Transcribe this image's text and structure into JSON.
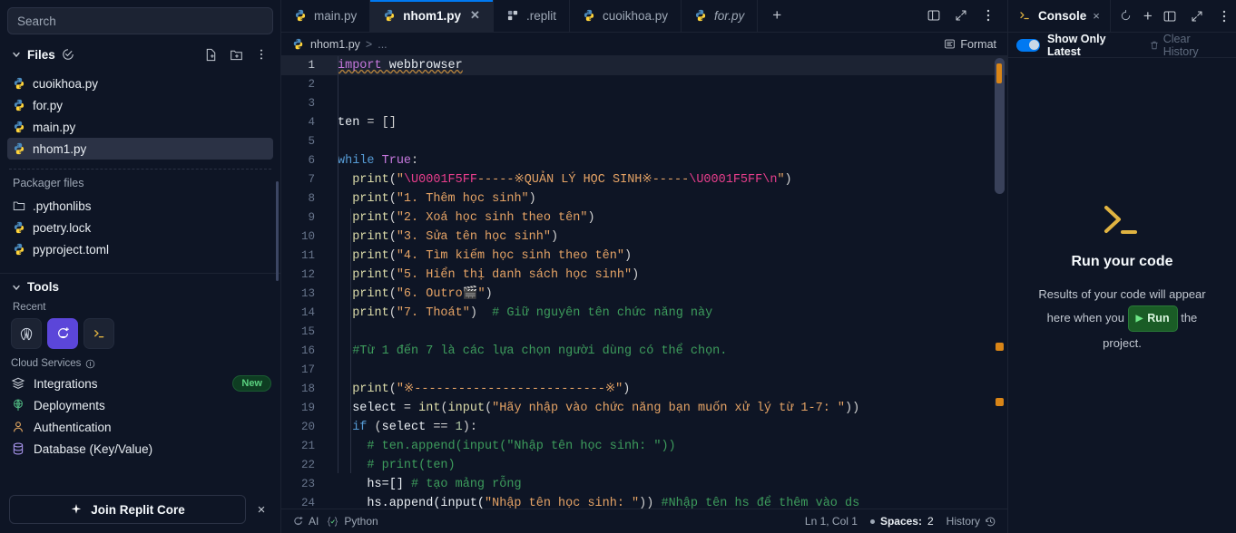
{
  "sidebar": {
    "search": {
      "placeholder": "Search",
      "name": "search-input"
    },
    "files_section": {
      "label": "Files"
    },
    "files": [
      {
        "label": "cuoikhoa.py",
        "icon": "python-icon",
        "active": false
      },
      {
        "label": "for.py",
        "icon": "python-icon",
        "active": false
      },
      {
        "label": "main.py",
        "icon": "python-icon",
        "active": false
      },
      {
        "label": "nhom1.py",
        "icon": "python-icon",
        "active": true
      }
    ],
    "packager_label": "Packager files",
    "packager_files": [
      {
        "label": ".pythonlibs",
        "icon": "folder-icon"
      },
      {
        "label": "poetry.lock",
        "icon": "python-icon"
      },
      {
        "label": "pyproject.toml",
        "icon": "python-icon"
      }
    ],
    "tools_section": {
      "label": "Tools"
    },
    "recent_label": "Recent",
    "recent_tools": [
      {
        "name": "shell-tool-icon",
        "selected": false
      },
      {
        "name": "replit-ai-tool-icon",
        "selected": true
      },
      {
        "name": "console-tool-icon",
        "selected": false
      }
    ],
    "cloud_label": "Cloud Services",
    "cloud_services": [
      {
        "label": "Integrations",
        "icon": "layers-icon",
        "badge": "New"
      },
      {
        "label": "Deployments",
        "icon": "globe-icon",
        "badge": ""
      },
      {
        "label": "Authentication",
        "icon": "person-icon",
        "badge": ""
      },
      {
        "label": "Database (Key/Value)",
        "icon": "database-icon",
        "badge": ""
      }
    ],
    "core_button": {
      "label": "Join Replit Core",
      "icon": "sparkle-icon"
    },
    "core_close": "×"
  },
  "tabs": [
    {
      "label": "main.py",
      "icon": "python-icon",
      "active": false,
      "italic": false,
      "closable": false
    },
    {
      "label": "nhom1.py",
      "icon": "python-icon",
      "active": true,
      "italic": false,
      "closable": true
    },
    {
      "label": ".replit",
      "icon": "replit-config-icon",
      "active": false,
      "italic": false,
      "closable": false
    },
    {
      "label": "cuoikhoa.py",
      "icon": "python-icon",
      "active": false,
      "italic": false,
      "closable": false
    },
    {
      "label": "for.py",
      "icon": "python-icon",
      "active": false,
      "italic": true,
      "closable": false
    }
  ],
  "tabbar": {
    "new_tab": "+",
    "split_icon": "split-pane-icon",
    "expand_icon": "expand-icon",
    "more_icon": "more-vertical-icon"
  },
  "breadcrumb": {
    "file": "nhom1.py",
    "separator": ">",
    "ellipsis": "...",
    "format_label": "Format"
  },
  "editor": {
    "lines": [
      {
        "n": "1",
        "tokens": [
          {
            "t": "import ",
            "c": "kp sq"
          },
          {
            "t": "webbrowser",
            "c": "id sq"
          }
        ],
        "highlight": true,
        "caret": true
      },
      {
        "n": "2",
        "tokens": []
      },
      {
        "n": "3",
        "tokens": []
      },
      {
        "n": "4",
        "tokens": [
          {
            "t": "ten",
            "c": "id"
          },
          {
            "t": " = ",
            "c": "op"
          },
          {
            "t": "[]",
            "c": "op"
          }
        ]
      },
      {
        "n": "5",
        "tokens": []
      },
      {
        "n": "6",
        "tokens": [
          {
            "t": "while",
            "c": "k"
          },
          {
            "t": " ",
            "c": "op"
          },
          {
            "t": "True",
            "c": "kp"
          },
          {
            "t": ":",
            "c": "op"
          }
        ]
      },
      {
        "n": "7",
        "tokens": [
          {
            "t": "  ",
            "c": "op"
          },
          {
            "t": "print",
            "c": "fn"
          },
          {
            "t": "(",
            "c": "op"
          },
          {
            "t": "\"",
            "c": "s"
          },
          {
            "t": "\\U0001F5FF",
            "c": "esc"
          },
          {
            "t": "-----※QUẢN LÝ HỌC SINH※-----",
            "c": "s"
          },
          {
            "t": "\\U0001F5FF",
            "c": "esc"
          },
          {
            "t": "\\n",
            "c": "esc"
          },
          {
            "t": "\"",
            "c": "s"
          },
          {
            "t": ")",
            "c": "op"
          }
        ]
      },
      {
        "n": "8",
        "tokens": [
          {
            "t": "  ",
            "c": "op"
          },
          {
            "t": "print",
            "c": "fn"
          },
          {
            "t": "(",
            "c": "op"
          },
          {
            "t": "\"1. Thêm học sinh\"",
            "c": "s"
          },
          {
            "t": ")",
            "c": "op"
          }
        ]
      },
      {
        "n": "9",
        "tokens": [
          {
            "t": "  ",
            "c": "op"
          },
          {
            "t": "print",
            "c": "fn"
          },
          {
            "t": "(",
            "c": "op"
          },
          {
            "t": "\"2. Xoá học sinh theo tên\"",
            "c": "s"
          },
          {
            "t": ")",
            "c": "op"
          }
        ]
      },
      {
        "n": "10",
        "tokens": [
          {
            "t": "  ",
            "c": "op"
          },
          {
            "t": "print",
            "c": "fn"
          },
          {
            "t": "(",
            "c": "op"
          },
          {
            "t": "\"3. Sửa tên học sinh\"",
            "c": "s"
          },
          {
            "t": ")",
            "c": "op"
          }
        ]
      },
      {
        "n": "11",
        "tokens": [
          {
            "t": "  ",
            "c": "op"
          },
          {
            "t": "print",
            "c": "fn"
          },
          {
            "t": "(",
            "c": "op"
          },
          {
            "t": "\"4. Tìm kiếm học sinh theo tên\"",
            "c": "s"
          },
          {
            "t": ")",
            "c": "op"
          }
        ]
      },
      {
        "n": "12",
        "tokens": [
          {
            "t": "  ",
            "c": "op"
          },
          {
            "t": "print",
            "c": "fn"
          },
          {
            "t": "(",
            "c": "op"
          },
          {
            "t": "\"5. Hiển thị danh sách học sinh\"",
            "c": "s"
          },
          {
            "t": ")",
            "c": "op"
          }
        ]
      },
      {
        "n": "13",
        "tokens": [
          {
            "t": "  ",
            "c": "op"
          },
          {
            "t": "print",
            "c": "fn"
          },
          {
            "t": "(",
            "c": "op"
          },
          {
            "t": "\"6. Outro🎬\"",
            "c": "s"
          },
          {
            "t": ")",
            "c": "op"
          }
        ]
      },
      {
        "n": "14",
        "tokens": [
          {
            "t": "  ",
            "c": "op"
          },
          {
            "t": "print",
            "c": "fn"
          },
          {
            "t": "(",
            "c": "op"
          },
          {
            "t": "\"7. Thoát\"",
            "c": "s"
          },
          {
            "t": ")",
            "c": "op"
          },
          {
            "t": "  # Giữ nguyên tên chức năng này",
            "c": "c"
          }
        ]
      },
      {
        "n": "15",
        "tokens": []
      },
      {
        "n": "16",
        "tokens": [
          {
            "t": "  #Từ 1 đến 7 là các lựa chọn người dùng có thể chọn.",
            "c": "c"
          }
        ]
      },
      {
        "n": "17",
        "tokens": []
      },
      {
        "n": "18",
        "tokens": [
          {
            "t": "  ",
            "c": "op"
          },
          {
            "t": "print",
            "c": "fn"
          },
          {
            "t": "(",
            "c": "op"
          },
          {
            "t": "\"※--------------------------※\"",
            "c": "s"
          },
          {
            "t": ")",
            "c": "op"
          }
        ]
      },
      {
        "n": "19",
        "tokens": [
          {
            "t": "  ",
            "c": "op"
          },
          {
            "t": "select",
            "c": "id"
          },
          {
            "t": " = ",
            "c": "op"
          },
          {
            "t": "int",
            "c": "fn"
          },
          {
            "t": "(",
            "c": "op"
          },
          {
            "t": "input",
            "c": "fn"
          },
          {
            "t": "(",
            "c": "op"
          },
          {
            "t": "\"Hãy nhập vào chức năng bạn muốn xử lý từ 1-7: \"",
            "c": "s"
          },
          {
            "t": "))",
            "c": "op"
          }
        ]
      },
      {
        "n": "20",
        "tokens": [
          {
            "t": "  ",
            "c": "op"
          },
          {
            "t": "if",
            "c": "k"
          },
          {
            "t": " (",
            "c": "op"
          },
          {
            "t": "select",
            "c": "id"
          },
          {
            "t": " == ",
            "c": "op"
          },
          {
            "t": "1",
            "c": "n"
          },
          {
            "t": "):",
            "c": "op"
          }
        ]
      },
      {
        "n": "21",
        "tokens": [
          {
            "t": "    # ten.append(input(\"Nhập tên học sinh: \"))",
            "c": "c"
          }
        ]
      },
      {
        "n": "22",
        "tokens": [
          {
            "t": "    # print(ten)",
            "c": "c"
          }
        ]
      },
      {
        "n": "23",
        "tokens": [
          {
            "t": "    ",
            "c": "op"
          },
          {
            "t": "hs=[]",
            "c": "id"
          },
          {
            "t": " # tạo mảng rỗng",
            "c": "c"
          }
        ]
      },
      {
        "n": "24",
        "tokens": [
          {
            "t": "    ",
            "c": "op"
          },
          {
            "t": "hs.append(input(",
            "c": "id"
          },
          {
            "t": "\"Nhập tên học sinh: \"",
            "c": "s"
          },
          {
            "t": "))",
            "c": "op"
          },
          {
            "t": " #Nhập tên hs để thêm vào ds",
            "c": "c"
          }
        ]
      }
    ]
  },
  "statusbar": {
    "ai_label": "AI",
    "ai_icon": "replit-ai-icon",
    "lang_label": "Python",
    "lang_icon": "braces-check-icon",
    "position": "Ln 1, Col 1",
    "spaces_key": "Spaces:",
    "spaces_value": "2",
    "history_label": "History",
    "history_icon": "history-clock-icon"
  },
  "console": {
    "tab_label": "Console",
    "tab_icon": "console-prompt-icon",
    "close": "×",
    "restart_icon": "restart-icon",
    "plus": "+",
    "split_icon": "split-pane-icon",
    "expand_icon": "expand-icon",
    "more_icon": "more-vertical-icon",
    "show_only_latest": "Show Only Latest",
    "clear_history": "Clear History",
    "clear_icon": "trash-icon",
    "empty_title": "Run your code",
    "empty_text_1": "Results of your code will appear",
    "empty_text_2": "here when you",
    "run_label": "Run",
    "empty_text_3": "the",
    "empty_text_4": "project."
  },
  "colors": {
    "bg": "#0e1525",
    "panel": "#1c2333",
    "accent_blue": "#0079f2",
    "accent_purple": "#5b46d9",
    "run_green": "#1a5c26",
    "string_orange": "#e5a365",
    "comment_green": "#3d9c5c",
    "escape_pink": "#e83e8c",
    "marker_orange": "#d98517"
  }
}
